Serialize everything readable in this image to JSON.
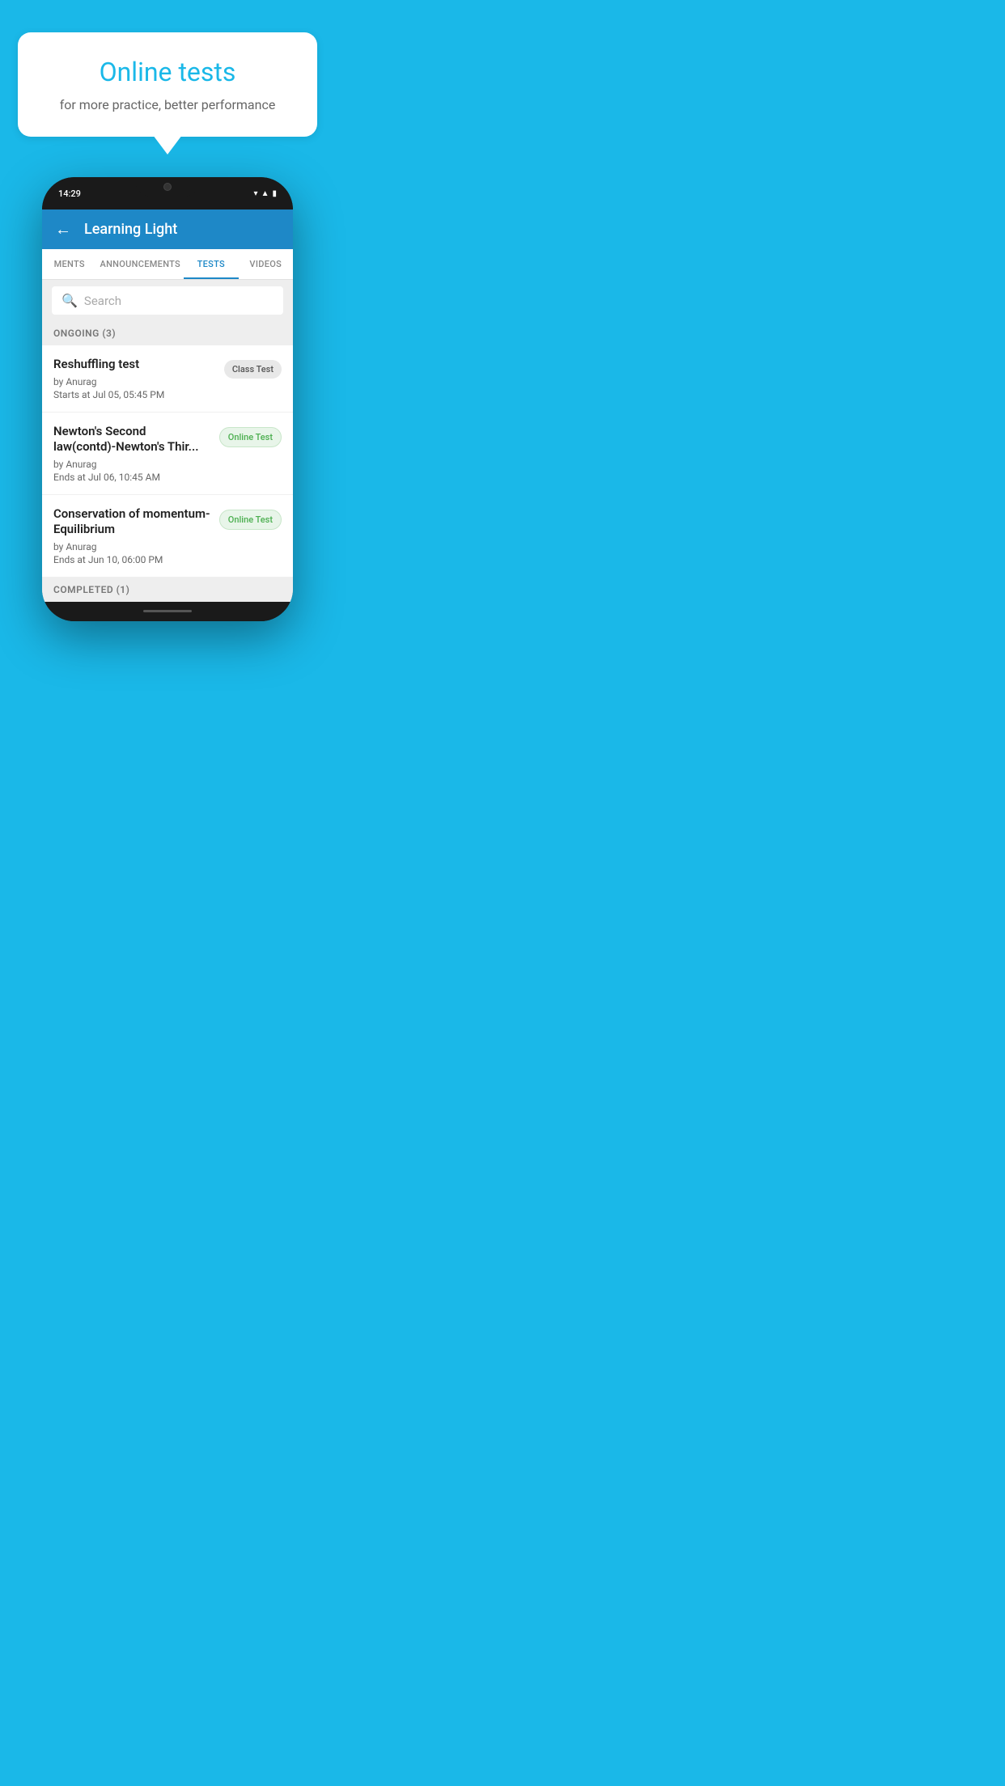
{
  "background_color": "#1ab8e8",
  "speech_bubble": {
    "title": "Online tests",
    "subtitle": "for more practice, better performance"
  },
  "phone": {
    "status_bar": {
      "time": "14:29",
      "icons": [
        "wifi",
        "signal",
        "battery"
      ]
    },
    "header": {
      "title": "Learning Light",
      "back_label": "←"
    },
    "tabs": [
      {
        "label": "MENTS",
        "active": false
      },
      {
        "label": "ANNOUNCEMENTS",
        "active": false
      },
      {
        "label": "TESTS",
        "active": true
      },
      {
        "label": "VIDEOS",
        "active": false
      }
    ],
    "search": {
      "placeholder": "Search"
    },
    "sections": [
      {
        "header": "ONGOING (3)",
        "items": [
          {
            "title": "Reshuffling test",
            "by": "by Anurag",
            "date": "Starts at  Jul 05, 05:45 PM",
            "badge": "Class Test",
            "badge_type": "class"
          },
          {
            "title": "Newton's Second law(contd)-Newton's Thir...",
            "by": "by Anurag",
            "date": "Ends at  Jul 06, 10:45 AM",
            "badge": "Online Test",
            "badge_type": "online"
          },
          {
            "title": "Conservation of momentum-Equilibrium",
            "by": "by Anurag",
            "date": "Ends at  Jun 10, 06:00 PM",
            "badge": "Online Test",
            "badge_type": "online"
          }
        ]
      }
    ],
    "completed_header": "COMPLETED (1)"
  }
}
